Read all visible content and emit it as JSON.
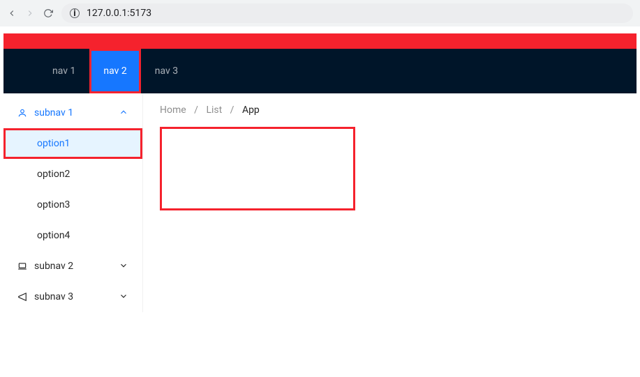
{
  "browser": {
    "url": "127.0.0.1:5173"
  },
  "topnav": {
    "items": [
      {
        "label": "nav 1",
        "active": false
      },
      {
        "label": "nav 2",
        "active": true
      },
      {
        "label": "nav 3",
        "active": false
      }
    ]
  },
  "sidebar": {
    "groups": [
      {
        "label": "subnav 1",
        "icon": "user",
        "open": true,
        "options": [
          {
            "label": "option1",
            "active": true
          },
          {
            "label": "option2",
            "active": false
          },
          {
            "label": "option3",
            "active": false
          },
          {
            "label": "option4",
            "active": false
          }
        ]
      },
      {
        "label": "subnav 2",
        "icon": "laptop",
        "open": false,
        "options": []
      },
      {
        "label": "subnav 3",
        "icon": "notification",
        "open": false,
        "options": []
      }
    ]
  },
  "breadcrumb": {
    "items": [
      "Home",
      "List",
      "App"
    ]
  }
}
